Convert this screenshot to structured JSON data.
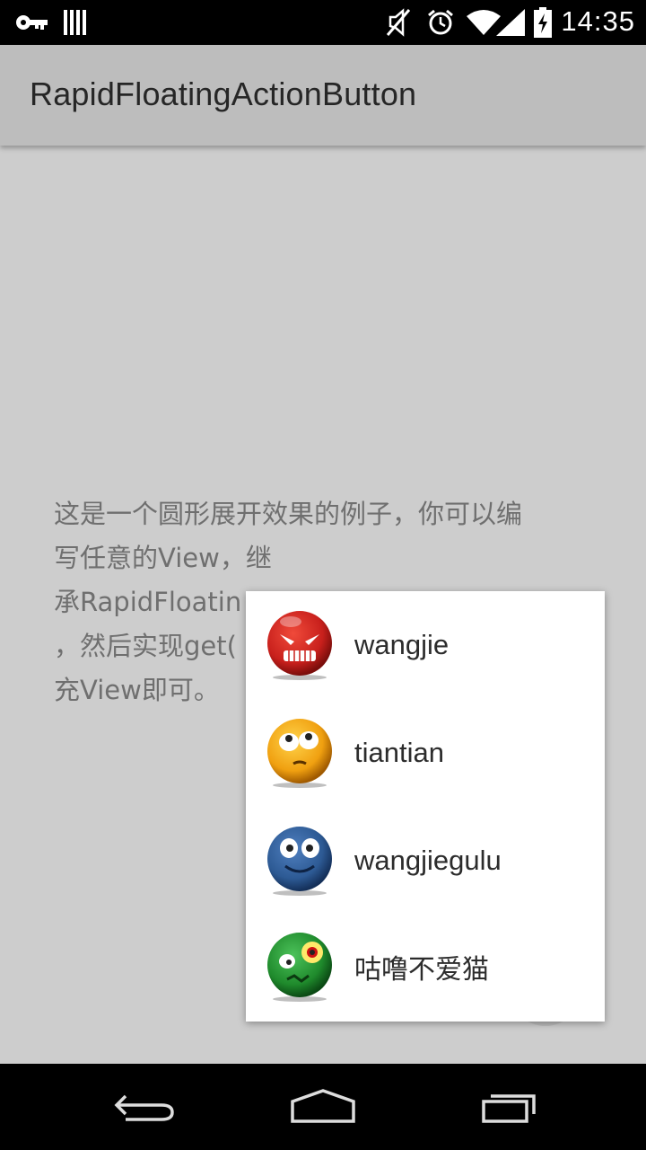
{
  "status_bar": {
    "time": "14:35",
    "icons": [
      "key-icon",
      "barcode-icon",
      "mute-icon",
      "alarm-icon",
      "wifi-icon",
      "signal-icon",
      "battery-icon"
    ]
  },
  "action_bar": {
    "title": "RapidFloatingActionButton"
  },
  "content": {
    "line1": "这是一个圆形展开效果的例子，你可以编",
    "line2": "写任意的View，继",
    "line3": "承RapidFloatin",
    "line4": "，然后实现get(",
    "line5": "充View即可。"
  },
  "popup_menu": {
    "items": [
      {
        "label": "wangjie",
        "avatar_icon": "red-angry-face-icon",
        "color": "#c8201c"
      },
      {
        "label": "tiantian",
        "avatar_icon": "orange-face-icon",
        "color": "#f0a010"
      },
      {
        "label": "wangjiegulu",
        "avatar_icon": "blue-face-icon",
        "color": "#2d5a94"
      },
      {
        "label": "咕噜不爱猫",
        "avatar_icon": "green-face-icon",
        "color": "#1f8a2c"
      }
    ]
  },
  "nav_bar": {
    "buttons": [
      "back-icon",
      "home-icon",
      "recents-icon"
    ]
  }
}
